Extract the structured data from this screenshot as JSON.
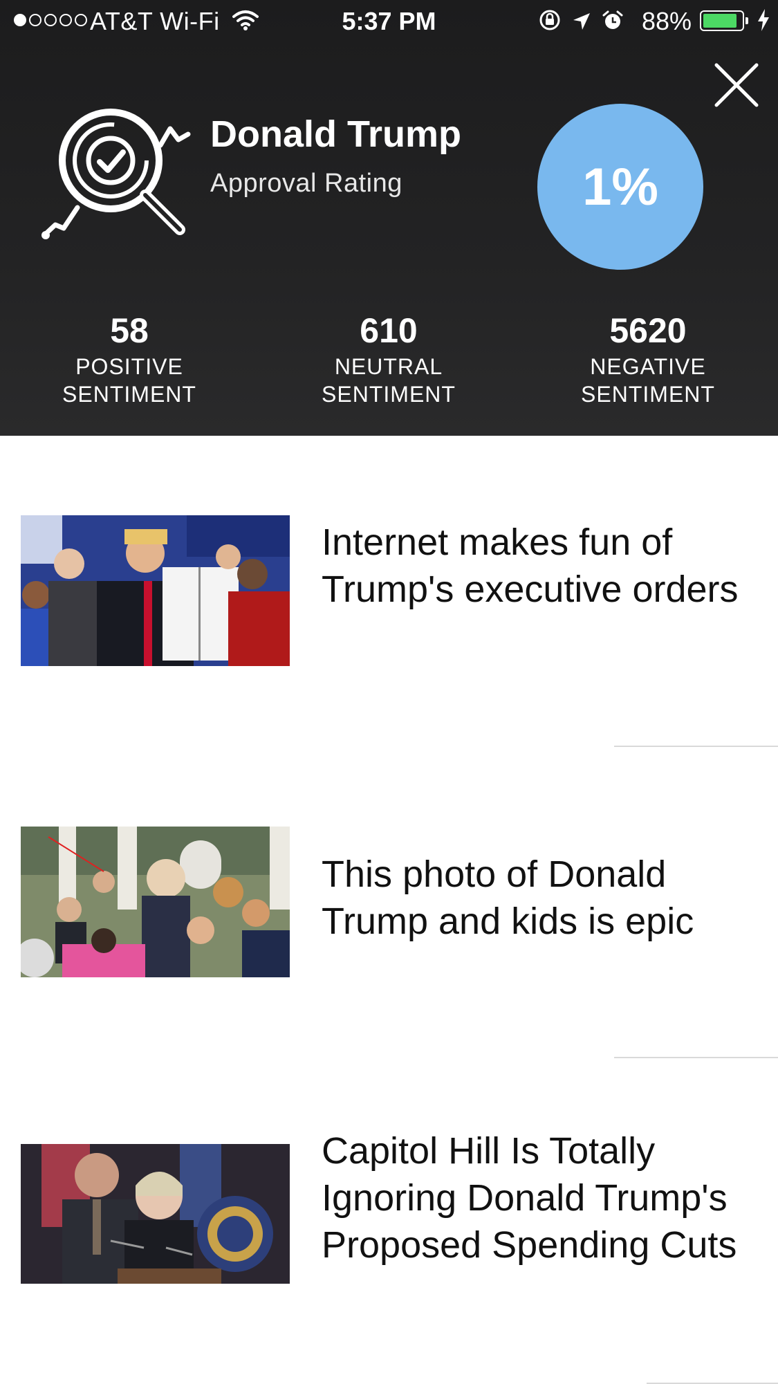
{
  "status_bar": {
    "carrier": "AT&T Wi-Fi",
    "time": "5:37 PM",
    "battery_percent": "88%",
    "battery_level": 0.88,
    "signal_strength": 1,
    "icons": [
      "signal-dots-icon",
      "wifi-icon",
      "rotation-lock-icon",
      "location-arrow-icon",
      "alarm-icon",
      "battery-icon",
      "charging-bolt-icon"
    ]
  },
  "header": {
    "title": "Donald Trump",
    "subtitle": "Approval Rating",
    "approval_value": "1%",
    "close_icon": "close-icon",
    "logo_icon": "magnifier-analytics-icon",
    "accent_color": "#79b8ee",
    "background_color": "#232324"
  },
  "stats": [
    {
      "value": "58",
      "label_line1": "POSITIVE",
      "label_line2": "SENTIMENT"
    },
    {
      "value": "610",
      "label_line1": "NEUTRAL",
      "label_line2": "SENTIMENT"
    },
    {
      "value": "5620",
      "label_line1": "NEGATIVE",
      "label_line2": "SENTIMENT"
    }
  ],
  "articles": [
    {
      "headline": "Internet makes fun of Trump's executive orders"
    },
    {
      "headline": "This photo of Donald Trump and kids is epic"
    },
    {
      "headline": "Capitol Hill Is Totally Ignoring Donald Trump's Proposed Spending Cuts"
    }
  ]
}
